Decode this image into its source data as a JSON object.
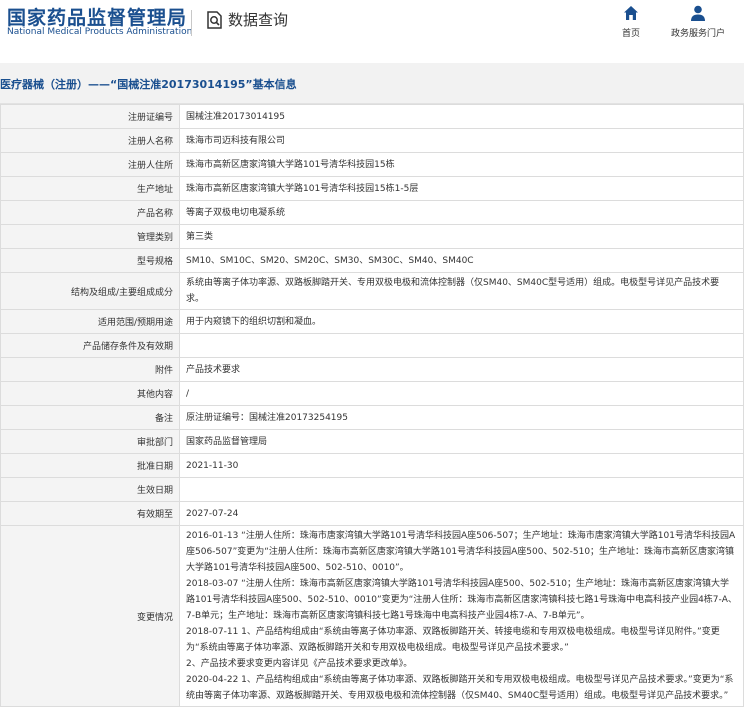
{
  "header": {
    "logo_cn": "国家药品监督管理局",
    "logo_en": "National Medical Products Administration",
    "section_icon": "search-document-icon",
    "section_title": "数据查询",
    "nav": [
      {
        "label": "首页",
        "icon": "home-icon"
      },
      {
        "label": "政务服务门户",
        "icon": "user-icon"
      }
    ]
  },
  "breadcrumb": "医疗器械（注册）——“国械注准20173014195”基本信息",
  "rows": [
    {
      "label": "注册证编号",
      "value": "国械注准20173014195"
    },
    {
      "label": "注册人名称",
      "value": "珠海市司迈科技有限公司"
    },
    {
      "label": "注册人住所",
      "value": "珠海市高新区唐家湾镇大学路101号清华科技园15栋"
    },
    {
      "label": "生产地址",
      "value": "珠海市高新区唐家湾镇大学路101号清华科技园15栋1-5层"
    },
    {
      "label": "产品名称",
      "value": "等离子双极电切电凝系统"
    },
    {
      "label": "管理类别",
      "value": "第三类"
    },
    {
      "label": "型号规格",
      "value": "SM10、SM10C、SM20、SM20C、SM30、SM30C、SM40、SM40C"
    },
    {
      "label": "结构及组成/主要组成成分",
      "value": "系统由等离子体功率源、双路板脚踏开关、专用双极电极和流体控制器（仅SM40、SM40C型号适用）组成。电极型号详见产品技术要求。"
    },
    {
      "label": "适用范围/预期用途",
      "value": "用于内窥镜下的组织切割和凝血。"
    },
    {
      "label": "产品储存条件及有效期",
      "value": ""
    },
    {
      "label": "附件",
      "value": "产品技术要求"
    },
    {
      "label": "其他内容",
      "value": "/"
    },
    {
      "label": "备注",
      "value": "原注册证编号：国械注准20173254195"
    },
    {
      "label": "审批部门",
      "value": "国家药品监督管理局"
    },
    {
      "label": "批准日期",
      "value": "2021-11-30"
    },
    {
      "label": "生效日期",
      "value": ""
    },
    {
      "label": "有效期至",
      "value": "2027-07-24"
    }
  ],
  "change_label": "变更情况",
  "change_lines": [
    "2016-01-13 “注册人住所：珠海市唐家湾镇大学路101号清华科技园A座506-507；生产地址：珠海市唐家湾镇大学路101号清华科技园A座506-507”变更为“注册人住所：珠海市高新区唐家湾镇大学路101号清华科技园A座500、502-510；生产地址：珠海市高新区唐家湾镇大学路101号清华科技园A座500、502-510、0010”。",
    "2018-03-07 “注册人住所：珠海市高新区唐家湾镇大学路101号清华科技园A座500、502-510；生产地址：珠海市高新区唐家湾镇大学路101号清华科技园A座500、502-510、0010”变更为“注册人住所：珠海市高新区唐家湾镇科技七路1号珠海中电高科技产业园4栋7-A、7-B单元；生产地址：珠海市高新区唐家湾镇科技七路1号珠海中电高科技产业园4栋7-A、7-B单元”。",
    "2018-07-11 1、产品结构组成由“系统由等离子体功率源、双路板脚踏开关、转接电缆和专用双极电极组成。电极型号详见附件。”变更为“系统由等离子体功率源、双路板脚踏开关和专用双极电极组成。电极型号详见产品技术要求。”",
    "2、产品技术要求变更内容详见《产品技术要求更改单》。",
    "2020-04-22 1、产品结构组成由“系统由等离子体功率源、双路板脚踏开关和专用双极电极组成。电极型号详见产品技术要求。”变更为“系统由等离子体功率源、双路板脚踏开关、专用双极电极和流体控制器（仅SM40、SM40C型号适用）组成。电极型号详见产品技术要求。”"
  ]
}
